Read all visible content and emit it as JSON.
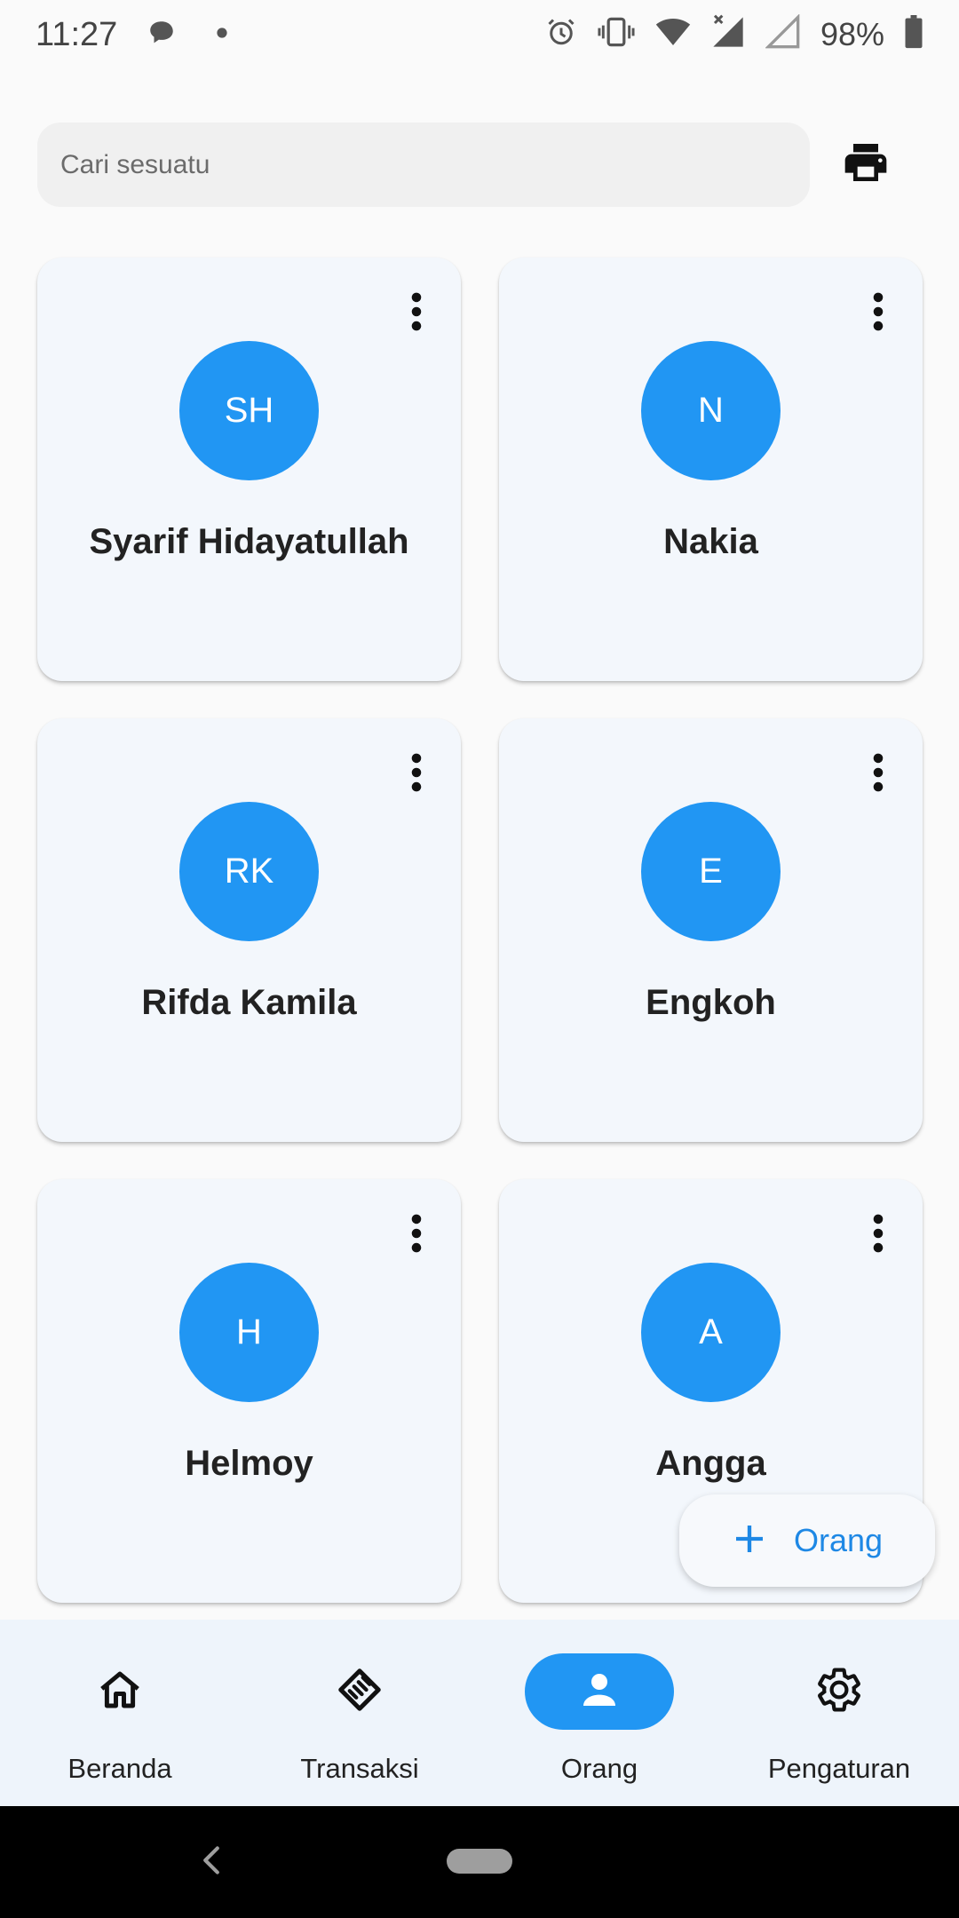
{
  "status_bar": {
    "time": "11:27",
    "battery": "98%",
    "icons": [
      "message-icon",
      "dot-icon",
      "alarm-icon",
      "vibrate-icon",
      "wifi-icon",
      "cell-signal-icon",
      "cell-signal-empty-icon",
      "battery-icon"
    ]
  },
  "search": {
    "placeholder": "Cari sesuatu",
    "value": ""
  },
  "toolbar": {
    "print_icon": "printer-icon"
  },
  "people": [
    {
      "initials": "SH",
      "name": "Syarif Hidayatullah"
    },
    {
      "initials": "N",
      "name": "Nakia"
    },
    {
      "initials": "RK",
      "name": "Rifda Kamila"
    },
    {
      "initials": "E",
      "name": "Engkoh"
    },
    {
      "initials": "H",
      "name": "Helmoy"
    },
    {
      "initials": "A",
      "name": "Angga"
    }
  ],
  "fab": {
    "label": "Orang",
    "icon": "plus-icon"
  },
  "bottom_nav": {
    "items": [
      {
        "label": "Beranda",
        "icon": "home-icon",
        "active": false
      },
      {
        "label": "Transaksi",
        "icon": "handshake-icon",
        "active": false
      },
      {
        "label": "Orang",
        "icon": "person-icon",
        "active": true
      },
      {
        "label": "Pengaturan",
        "icon": "gear-icon",
        "active": false
      }
    ]
  },
  "colors": {
    "accent": "#2196f3",
    "fab_text": "#1e88e5",
    "card_bg": "#f3f7fc",
    "nav_bg": "#eef4fb"
  }
}
